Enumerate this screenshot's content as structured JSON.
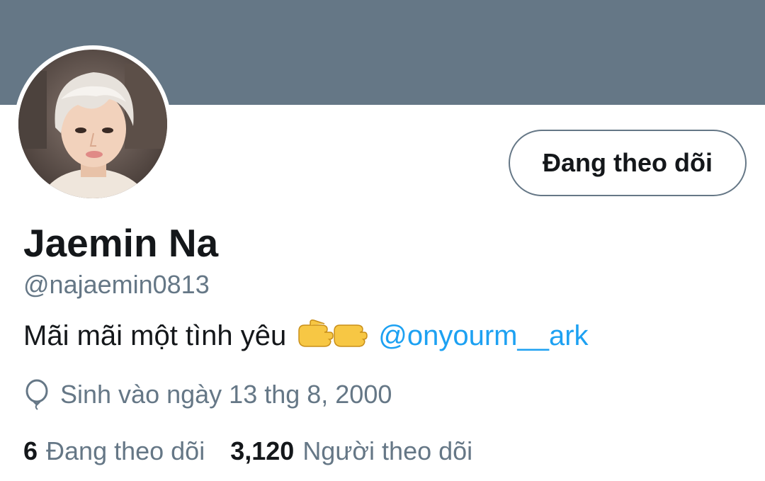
{
  "profile": {
    "display_name": "Jaemin Na",
    "handle": "@najaemin0813",
    "bio_text": "Mãi mãi một tình yêu",
    "bio_emoji": "pointing-hands-emoji",
    "bio_mention": "@onyourm__ark",
    "birth_text": "Sinh vào ngày 13 thg 8, 2000",
    "birth_icon": "balloon-icon"
  },
  "follow_button": {
    "label": "Đang theo dõi"
  },
  "stats": {
    "following_count": "6",
    "following_label": "Đang theo dõi",
    "followers_count": "3,120",
    "followers_label": "Người theo dõi"
  },
  "colors": {
    "banner": "#657786",
    "text_primary": "#14171a",
    "text_secondary": "#657786",
    "link": "#1da1f2"
  }
}
